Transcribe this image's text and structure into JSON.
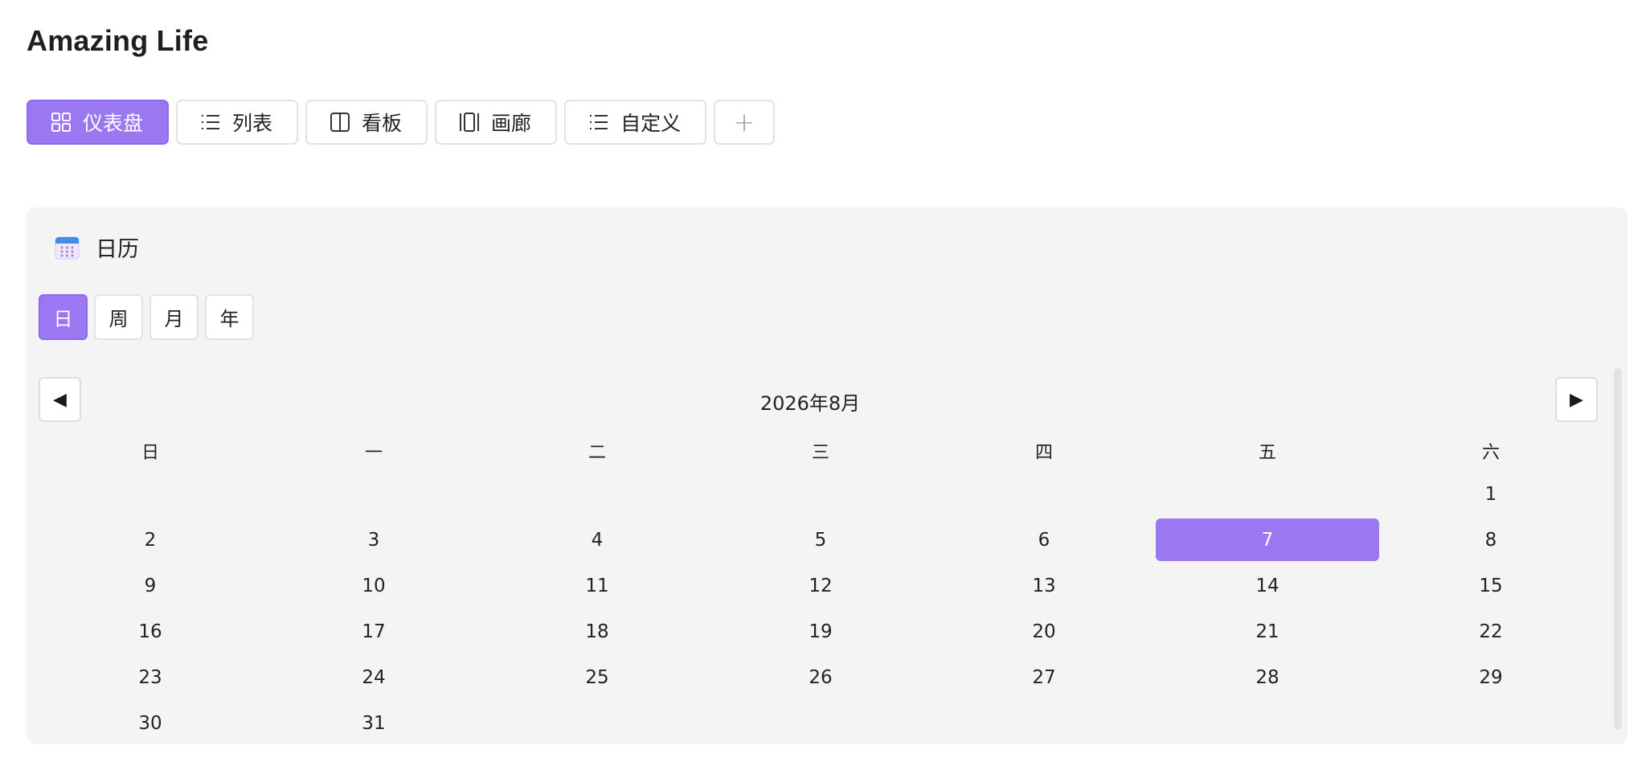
{
  "page": {
    "title": "Amazing Life"
  },
  "view_tabs": [
    {
      "label": "仪表盘",
      "icon": "grid-icon",
      "active": true
    },
    {
      "label": "列表",
      "icon": "list-icon",
      "active": false
    },
    {
      "label": "看板",
      "icon": "board-icon",
      "active": false
    },
    {
      "label": "画廊",
      "icon": "gallery-icon",
      "active": false
    },
    {
      "label": "自定义",
      "icon": "list-icon",
      "active": false
    }
  ],
  "add_tab": {
    "label": "+"
  },
  "calendar": {
    "title": "日历",
    "icon": "calendar-icon",
    "modes": [
      {
        "label": "日",
        "active": true
      },
      {
        "label": "周",
        "active": false
      },
      {
        "label": "月",
        "active": false
      },
      {
        "label": "年",
        "active": false
      }
    ],
    "prev_label": "◀",
    "next_label": "▶",
    "month_label": "2026年8月",
    "weekdays": [
      "日",
      "一",
      "二",
      "三",
      "四",
      "五",
      "六"
    ],
    "weeks": [
      [
        "",
        "",
        "",
        "",
        "",
        "",
        "1"
      ],
      [
        "2",
        "3",
        "4",
        "5",
        "6",
        "7",
        "8"
      ],
      [
        "9",
        "10",
        "11",
        "12",
        "13",
        "14",
        "15"
      ],
      [
        "16",
        "17",
        "18",
        "19",
        "20",
        "21",
        "22"
      ],
      [
        "23",
        "24",
        "25",
        "26",
        "27",
        "28",
        "29"
      ],
      [
        "30",
        "31",
        "",
        "",
        "",
        "",
        ""
      ]
    ],
    "selected_day": "7"
  },
  "colors": {
    "accent": "#9b78f2",
    "panel_bg": "#f4f4f4"
  }
}
